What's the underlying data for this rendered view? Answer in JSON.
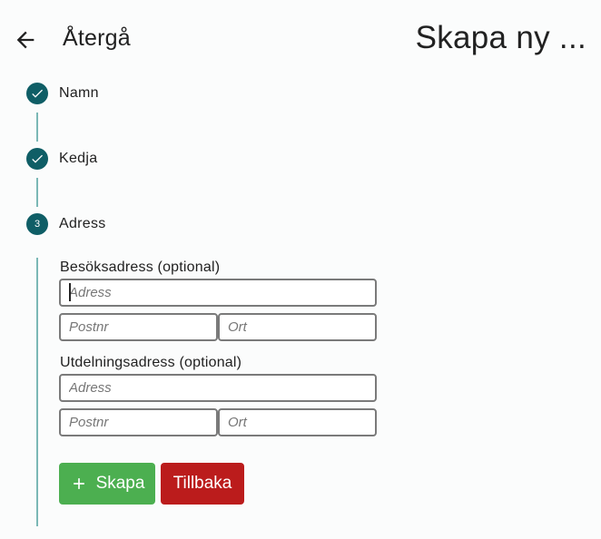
{
  "header": {
    "back_label": "Återgå",
    "title": "Skapa ny ..."
  },
  "steps": [
    {
      "label": "Namn",
      "state": "completed"
    },
    {
      "label": "Kedja",
      "state": "completed"
    },
    {
      "label": "Adress",
      "state": "active",
      "number": "3"
    }
  ],
  "visiting": {
    "label": "Besöksadress (optional)",
    "address_placeholder": "Adress",
    "postal_placeholder": "Postnr",
    "city_placeholder": "Ort"
  },
  "delivery": {
    "label": "Utdelningsadress (optional)",
    "address_placeholder": "Adress",
    "postal_placeholder": "Postnr",
    "city_placeholder": "Ort"
  },
  "buttons": {
    "create_label": "Skapa",
    "back_label": "Tillbaka"
  },
  "colors": {
    "step": "#0f5e66",
    "connector": "#7bb8b6",
    "create": "#4caf50",
    "back": "#bb1c1c"
  }
}
